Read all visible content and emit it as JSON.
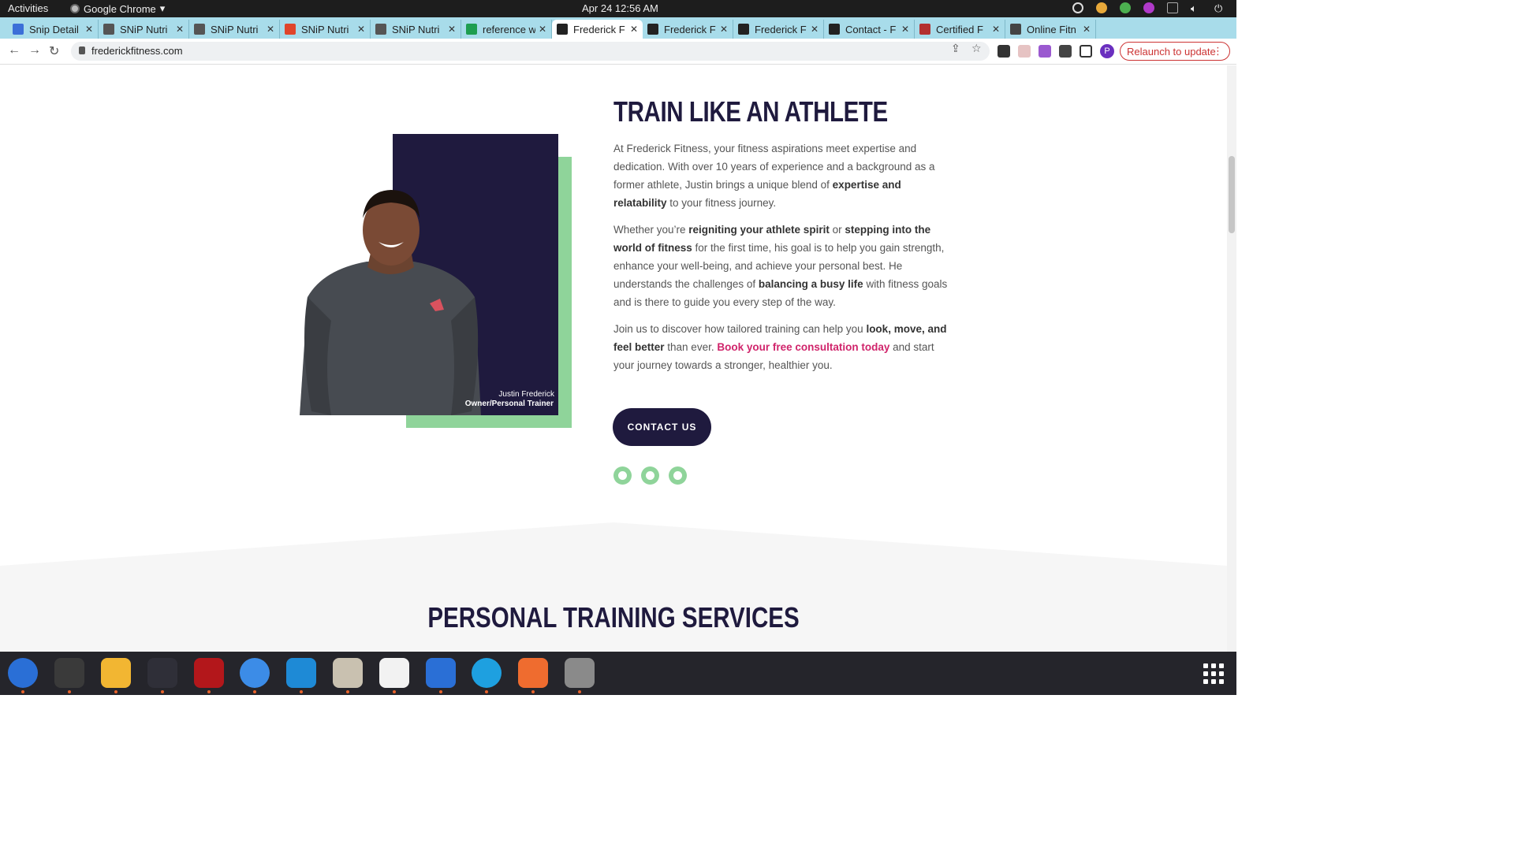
{
  "system": {
    "activities": "Activities",
    "app_name": "Google Chrome",
    "clock": "Apr 24  12:56 AM"
  },
  "tabs": [
    {
      "label": "Snip Detail",
      "color": "#3b6fd8"
    },
    {
      "label": "SNiP Nutri",
      "color": "#555555"
    },
    {
      "label": "SNiP Nutri",
      "color": "#555555"
    },
    {
      "label": "SNiP Nutri",
      "color": "#e0452b"
    },
    {
      "label": "SNiP Nutri",
      "color": "#555555"
    },
    {
      "label": "reference w",
      "color": "#1e9e50"
    },
    {
      "label": "Frederick F",
      "color": "#222222"
    },
    {
      "label": "Frederick F",
      "color": "#222222"
    },
    {
      "label": "Frederick F",
      "color": "#222222"
    },
    {
      "label": "Contact - F",
      "color": "#222222"
    },
    {
      "label": "Certified F",
      "color": "#b33030"
    },
    {
      "label": "Online Fitn",
      "color": "#444444"
    }
  ],
  "toolbar": {
    "url": "frederickfitness.com",
    "relaunch_label": "Relaunch to update",
    "profile_initial": "P"
  },
  "page": {
    "heading": "TRAIN LIKE AN ATHLETE",
    "photo_caption_name": "Justin Frederick",
    "photo_caption_role": "Owner/Personal Trainer",
    "p1_a": "At Frederick Fitness, your fitness aspirations meet expertise and dedication. With over 10 years of experience and a background as a former athlete, Justin brings a unique blend of ",
    "p1_b": "expertise and relatability",
    "p1_c": " to your fitness journey.",
    "p2_a": "Whether you’re ",
    "p2_b": "reigniting your athlete spirit",
    "p2_c": " or ",
    "p2_d": "stepping into the world of fitness",
    "p2_e": " for the first time, his goal is to help you gain strength, enhance your well-being, and achieve your personal best. He understands the challenges of ",
    "p2_f": "balancing a busy life",
    "p2_g": " with fitness goals and is there to guide you every step of the way.",
    "p3_a": "Join us to discover how tailored training can help you ",
    "p3_b": "look, move, and feel better",
    "p3_c": " than ever. ",
    "p3_d": "Book your free consultation today",
    "p3_e": " and start your journey towards a stronger, healthier you.",
    "contact_button": "CONTACT US",
    "social": [
      "facebook-icon",
      "twitter-icon",
      "instagram-icon"
    ],
    "services_heading": "PERSONAL TRAINING SERVICES"
  },
  "colors": {
    "navy": "#1f1a3e",
    "green": "#8fd49a",
    "pink_link": "#d0246b"
  },
  "dock": [
    {
      "name": "thunderbird-icon",
      "color": "#2a6fd6"
    },
    {
      "name": "terminal-icon",
      "color": "#3a3a3a"
    },
    {
      "name": "calculator-icon",
      "color": "#f2b632"
    },
    {
      "name": "system-monitor-icon",
      "color": "#2f2f38"
    },
    {
      "name": "filezilla-icon",
      "color": "#b3171b"
    },
    {
      "name": "chrome-icon",
      "color": "#3c8ce7"
    },
    {
      "name": "vscode-icon",
      "color": "#1e8ad6"
    },
    {
      "name": "files-icon",
      "color": "#c9c1b0"
    },
    {
      "name": "text-editor-icon",
      "color": "#f2f2f2"
    },
    {
      "name": "libreoffice-writer-icon",
      "color": "#2a6fd6"
    },
    {
      "name": "skype-icon",
      "color": "#1ea0e0"
    },
    {
      "name": "postman-icon",
      "color": "#ef6c2f"
    },
    {
      "name": "disk-utility-icon",
      "color": "#8a8a8a"
    }
  ]
}
